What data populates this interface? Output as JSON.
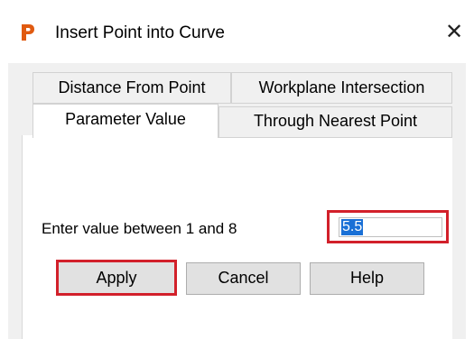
{
  "window": {
    "title": "Insert Point into Curve",
    "close_glyph": "✕",
    "icon": "app-logo-icon",
    "brand_color": "#e05a10"
  },
  "tabs": {
    "back_row": [
      {
        "label": "Distance From Point"
      },
      {
        "label": "Workplane Intersection"
      }
    ],
    "front_row": [
      {
        "label": "Parameter Value",
        "selected": true
      },
      {
        "label": "Through Nearest Point",
        "selected": false
      }
    ]
  },
  "form": {
    "prompt_label": "Enter value between 1 and 8",
    "value": "5.5",
    "highlight_color": "#d2202a"
  },
  "buttons": {
    "apply": "Apply",
    "cancel": "Cancel",
    "help": "Help"
  }
}
